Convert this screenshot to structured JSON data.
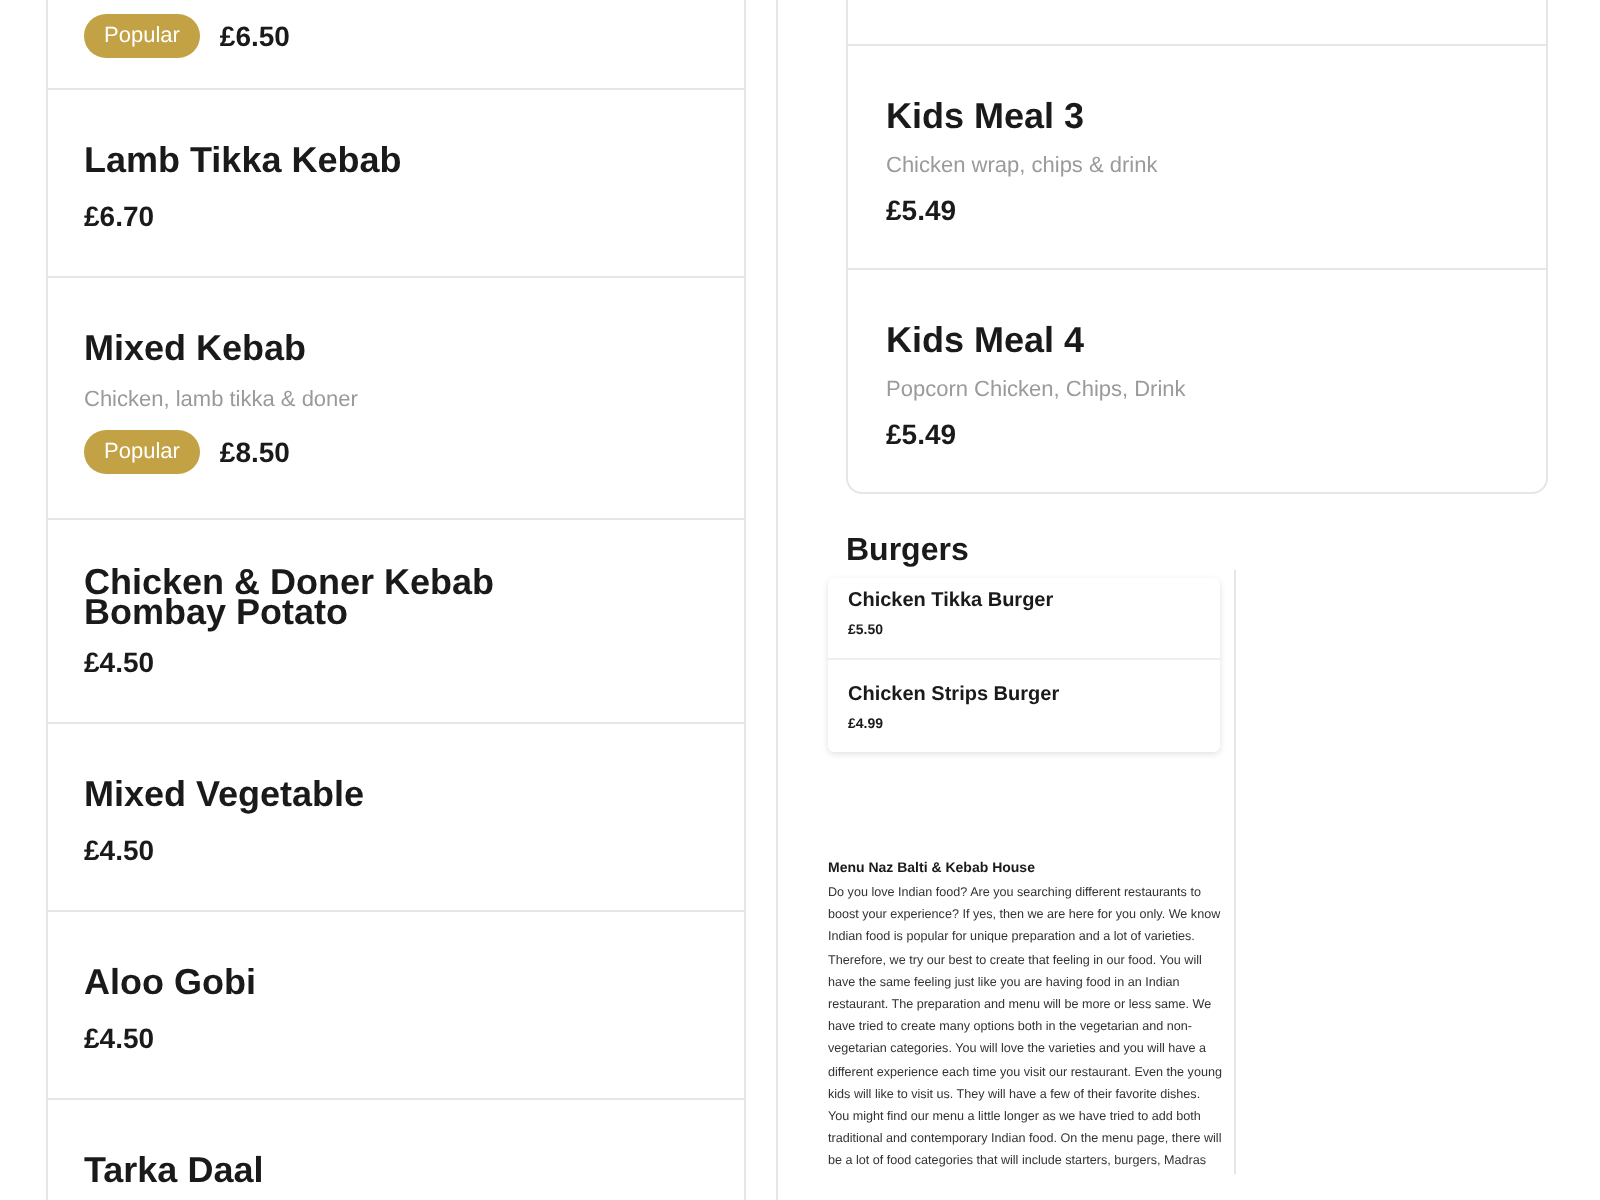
{
  "left_items": [
    {
      "badge": "Popular",
      "price": "£6.50"
    },
    {
      "names": [
        "Lamb Tikka Kebab"
      ],
      "price": "£6.70"
    },
    {
      "names": [
        "Mixed Kebab"
      ],
      "description": "Chicken, lamb tikka & doner",
      "badge": "Popular",
      "price": "£8.50"
    },
    {
      "names": [
        "Chicken & Doner Kebab",
        "Bombay Potato"
      ],
      "price": "£4.50"
    },
    {
      "names": [
        "Mixed Vegetable"
      ],
      "price": "£4.50"
    },
    {
      "names": [
        "Aloo Gobi"
      ],
      "price": "£4.50"
    },
    {
      "names": [
        "Tarka Daal"
      ]
    }
  ],
  "kids_items": [
    {
      "name": "Kids Meal 3",
      "description": "Chicken wrap, chips & drink",
      "price": "£5.49"
    },
    {
      "name": "Kids Meal 4",
      "description": "Popcorn Chicken, Chips, Drink",
      "price": "£5.49"
    }
  ],
  "section_title": "Burgers",
  "burgers": [
    {
      "name": "Chicken Tikka Burger",
      "price": "£5.50"
    },
    {
      "name": "Chicken Strips Burger",
      "price": "£4.99"
    }
  ],
  "about": {
    "title": "Menu Naz Balti & Kebab House",
    "text": "Do you love Indian food? Are you searching different restaurants to boost your experience? If yes, then we are here for you only. We know Indian food is popular for unique preparation and a lot of varieties. Therefore, we try our best to create that feeling in our food. You will have the same feeling just like you are having food in an Indian restaurant. The preparation and menu will be more or less same. We have tried to create many options both in the vegetarian and non-vegetarian categories. You will love the varieties and you will have a different experience each time you visit our restaurant. Even the young kids will like to visit us. They will have a few of their favorite dishes. You might find our menu a little longer as we have tried to add both traditional and contemporary Indian food. On the menu page, there will be a lot of food categories that will include starters, burgers, Madras"
  }
}
